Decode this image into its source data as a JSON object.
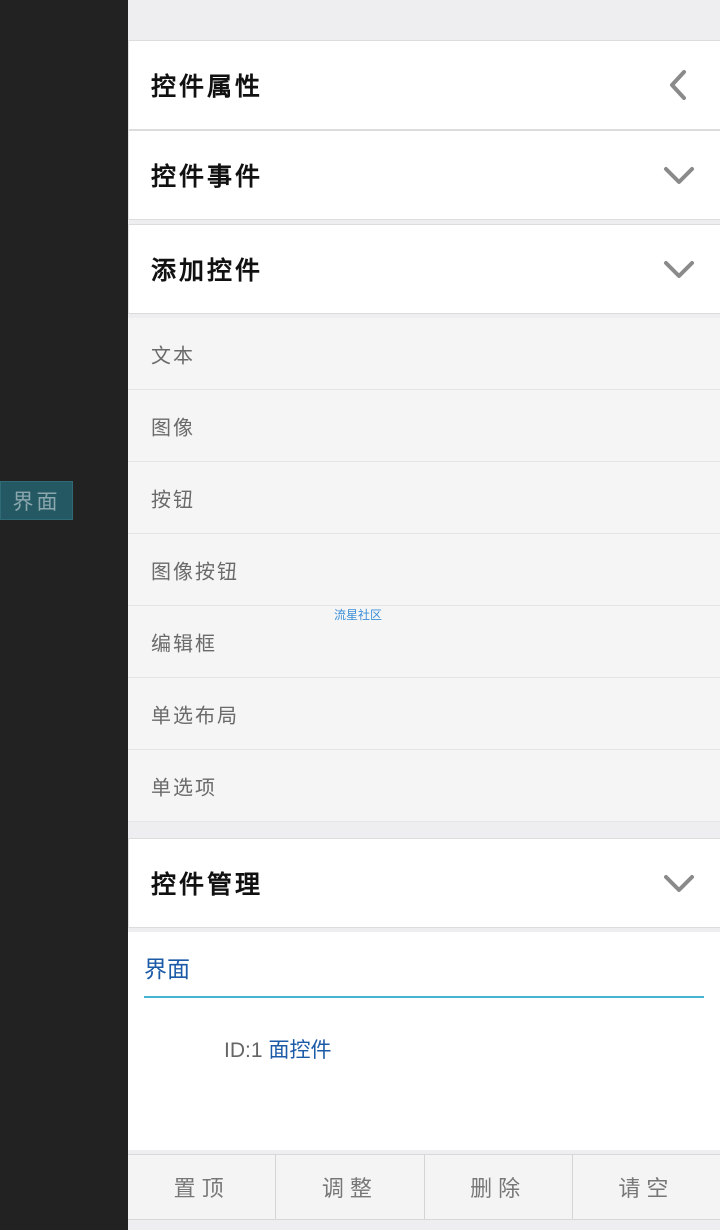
{
  "left_tab": {
    "label": "界面"
  },
  "sections": {
    "properties": {
      "title": "控件属性",
      "icon": "chevron-left-icon"
    },
    "events": {
      "title": "控件事件",
      "icon": "chevron-down-icon"
    },
    "add_control": {
      "title": "添加控件",
      "icon": "chevron-down-icon"
    },
    "manage": {
      "title": "控件管理",
      "icon": "chevron-down-icon"
    }
  },
  "control_types": [
    "文本",
    "图像",
    "按钮",
    "图像按钮",
    "编辑框",
    "单选布局",
    "单选项"
  ],
  "watermark": "流星社区",
  "tree": {
    "root": "界面",
    "node": {
      "id": "ID:1",
      "name": "面控件"
    }
  },
  "bottom_bar": [
    "置顶",
    "调整",
    "删除",
    "请空"
  ],
  "colors": {
    "accent_line": "#45b5d3",
    "link_blue": "#1a5aa6",
    "sidebar": "#222222"
  }
}
